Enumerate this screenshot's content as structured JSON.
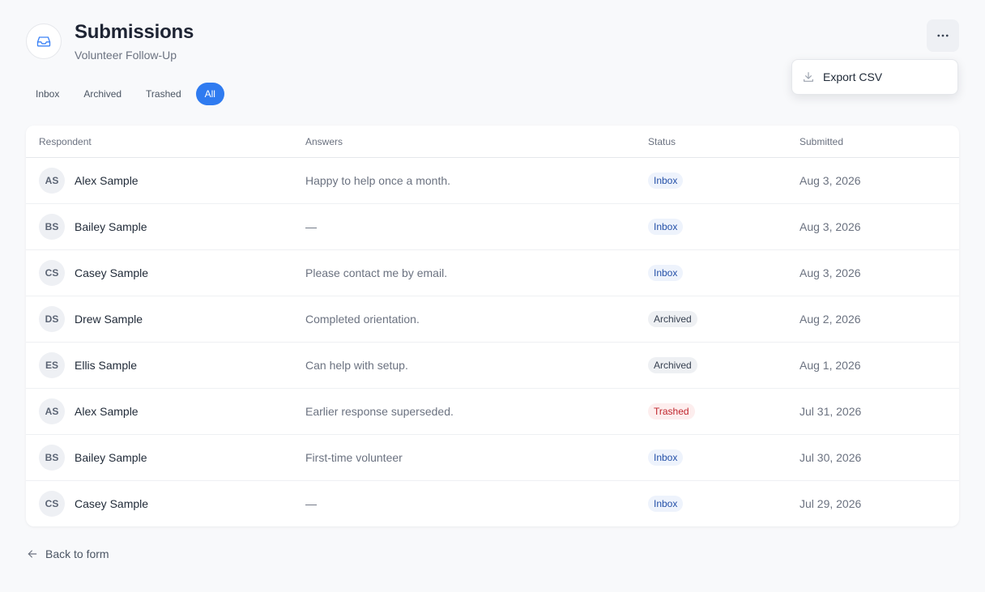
{
  "header": {
    "title": "Submissions",
    "subtitle": "Volunteer Follow-Up",
    "icon": "inbox-icon",
    "more_icon": "more-horizontal-icon"
  },
  "menu": {
    "items": [
      {
        "label": "Export CSV",
        "icon": "download-icon"
      }
    ]
  },
  "tabs": [
    {
      "label": "Inbox",
      "active": false
    },
    {
      "label": "Archived",
      "active": false
    },
    {
      "label": "Trashed",
      "active": false
    },
    {
      "label": "All",
      "active": true
    }
  ],
  "table": {
    "columns": [
      "Respondent",
      "Answers",
      "Status",
      "Submitted"
    ],
    "rows": [
      {
        "initials": "AS",
        "name": "Alex Sample",
        "answer": "Happy to help once a month.",
        "status": "Inbox",
        "status_kind": "inbox",
        "date": "Aug 3, 2026"
      },
      {
        "initials": "BS",
        "name": "Bailey Sample",
        "answer": "—",
        "status": "Inbox",
        "status_kind": "inbox",
        "date": "Aug 3, 2026"
      },
      {
        "initials": "CS",
        "name": "Casey Sample",
        "answer": "Please contact me by email.",
        "status": "Inbox",
        "status_kind": "inbox",
        "date": "Aug 3, 2026"
      },
      {
        "initials": "DS",
        "name": "Drew Sample",
        "answer": "Completed orientation.",
        "status": "Archived",
        "status_kind": "archived",
        "date": "Aug 2, 2026"
      },
      {
        "initials": "ES",
        "name": "Ellis Sample",
        "answer": "Can help with setup.",
        "status": "Archived",
        "status_kind": "archived",
        "date": "Aug 1, 2026"
      },
      {
        "initials": "AS",
        "name": "Alex Sample",
        "answer": "Earlier response superseded.",
        "status": "Trashed",
        "status_kind": "trashed",
        "date": "Jul 31, 2026"
      },
      {
        "initials": "BS",
        "name": "Bailey Sample",
        "answer": "First-time volunteer",
        "status": "Inbox",
        "status_kind": "inbox",
        "date": "Jul 30, 2026"
      },
      {
        "initials": "CS",
        "name": "Casey Sample",
        "answer": "—",
        "status": "Inbox",
        "status_kind": "inbox",
        "date": "Jul 29, 2026"
      }
    ]
  },
  "footer": {
    "back_label": "Back to form",
    "back_icon": "arrow-left-icon"
  },
  "colors": {
    "accent": "#2f7bf0",
    "inbox_badge_bg": "#eef3fc",
    "archived_badge_bg": "#eef0f3",
    "trashed_badge_bg": "#fdeeee"
  }
}
